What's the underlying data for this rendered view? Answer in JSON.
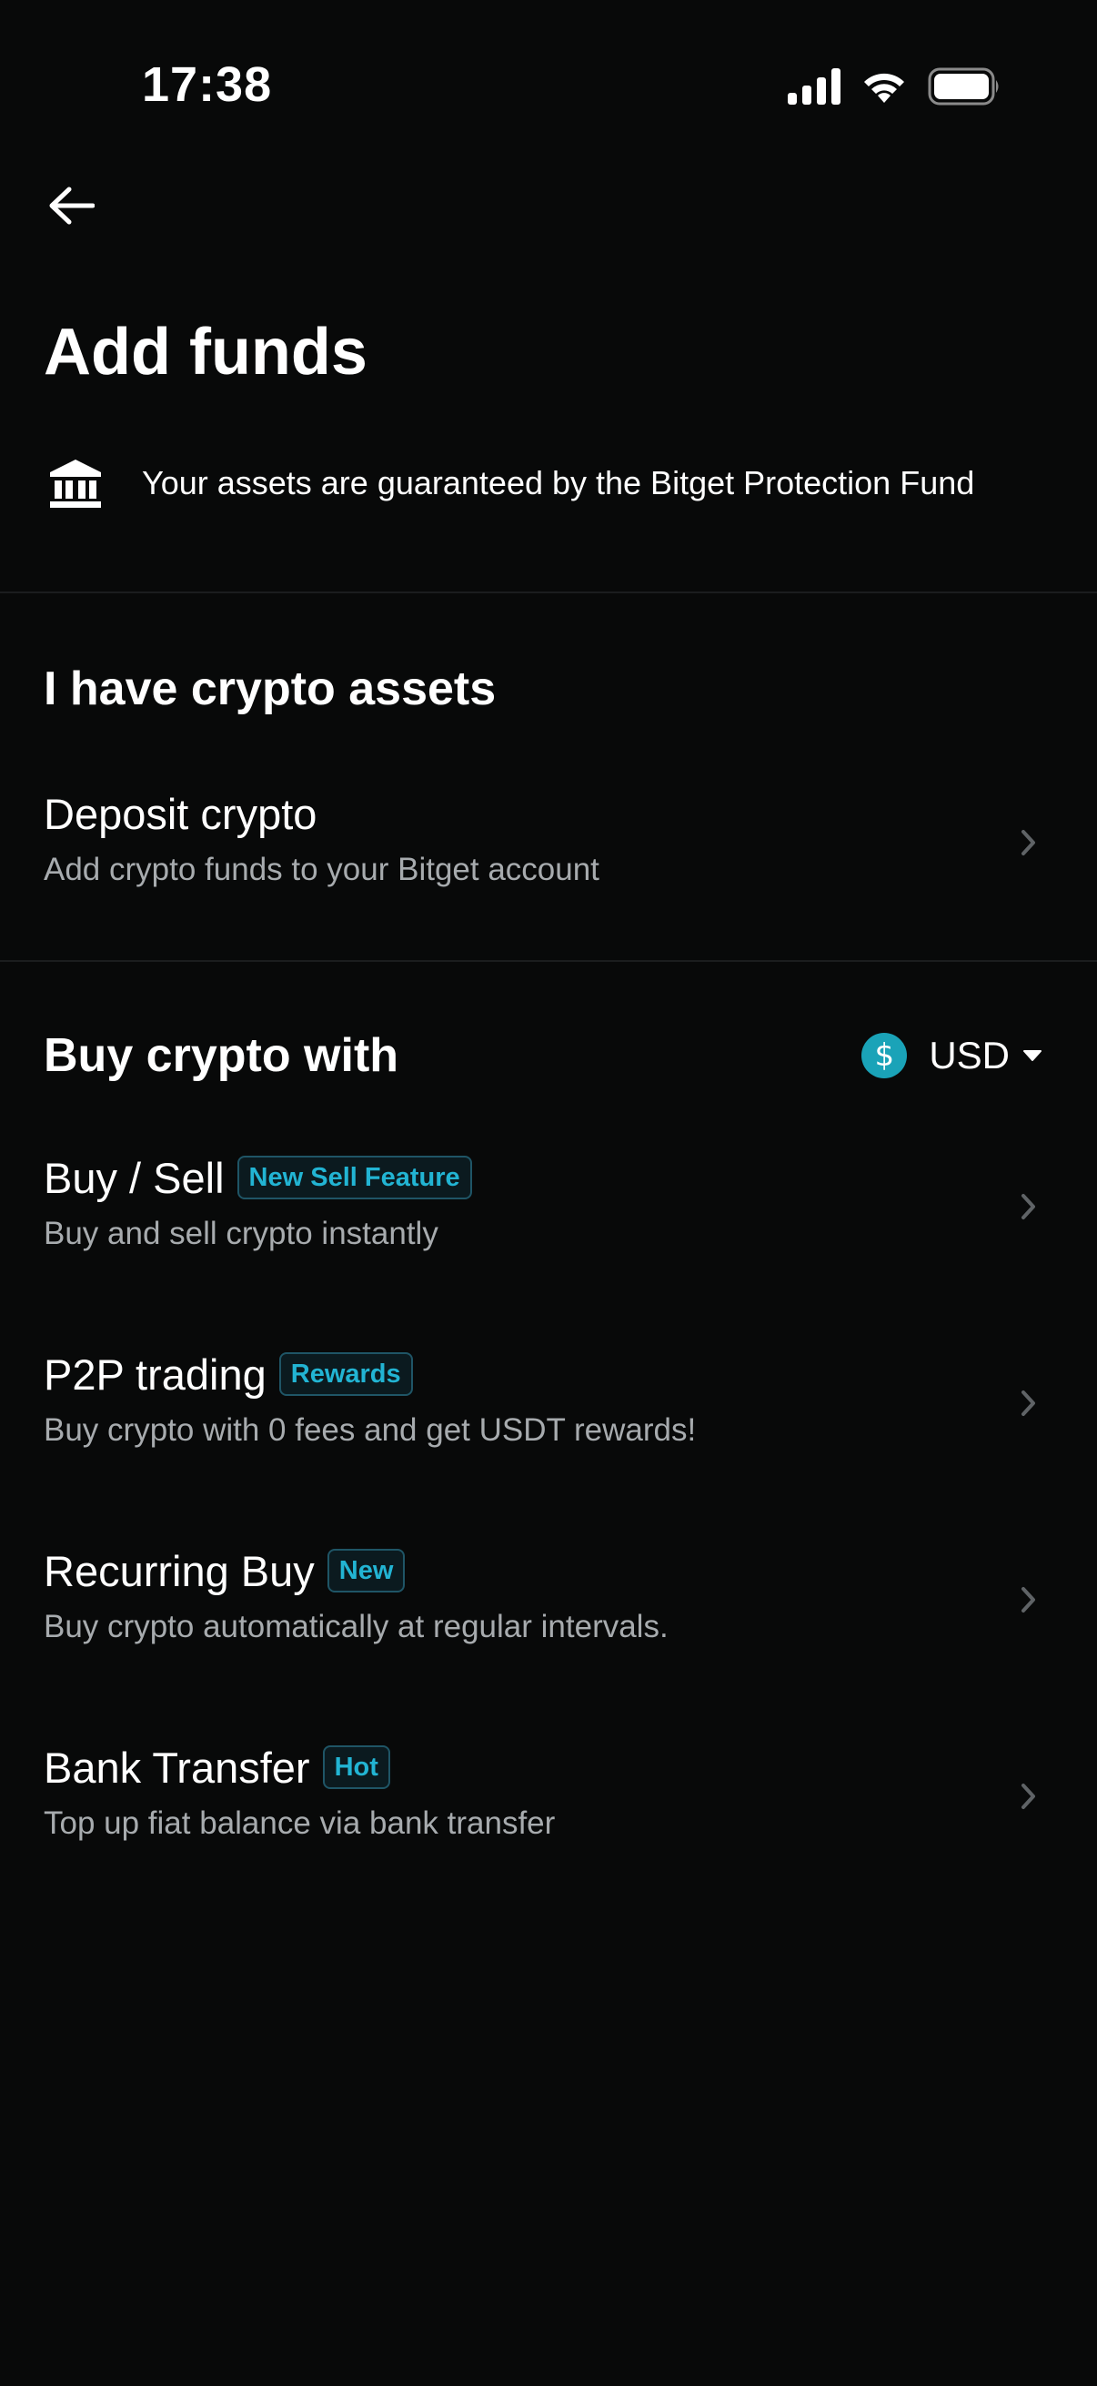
{
  "status_bar": {
    "time": "17:38",
    "icons": [
      "signal-icon",
      "wifi-icon",
      "battery-icon"
    ]
  },
  "header": {
    "back_icon": "back-arrow-icon",
    "title": "Add funds"
  },
  "notice": {
    "icon": "bank-icon",
    "text": "Your assets are guaranteed by the Bitget Protection Fund"
  },
  "crypto_section": {
    "title": "I have crypto assets",
    "items": [
      {
        "title": "Deposit crypto",
        "subtitle": "Add crypto funds to your Bitget account"
      }
    ]
  },
  "buy_section": {
    "title": "Buy crypto with",
    "currency": {
      "icon": "dollar-coin-icon",
      "symbol": "$",
      "label": "USD"
    },
    "items": [
      {
        "title": "Buy / Sell",
        "badge": "New Sell Feature",
        "subtitle": "Buy and sell crypto instantly"
      },
      {
        "title": "P2P trading",
        "badge": "Rewards",
        "subtitle": "Buy crypto with 0 fees and get USDT rewards!"
      },
      {
        "title": "Recurring Buy",
        "badge": "New",
        "subtitle": "Buy crypto automatically at regular intervals."
      },
      {
        "title": "Bank Transfer",
        "badge": "Hot",
        "subtitle": "Top up fiat balance via bank transfer"
      }
    ]
  },
  "colors": {
    "background": "#080909",
    "accent": "#22b4d3",
    "secondary_text": "#a7abae",
    "coin": "#1aa3b8"
  }
}
